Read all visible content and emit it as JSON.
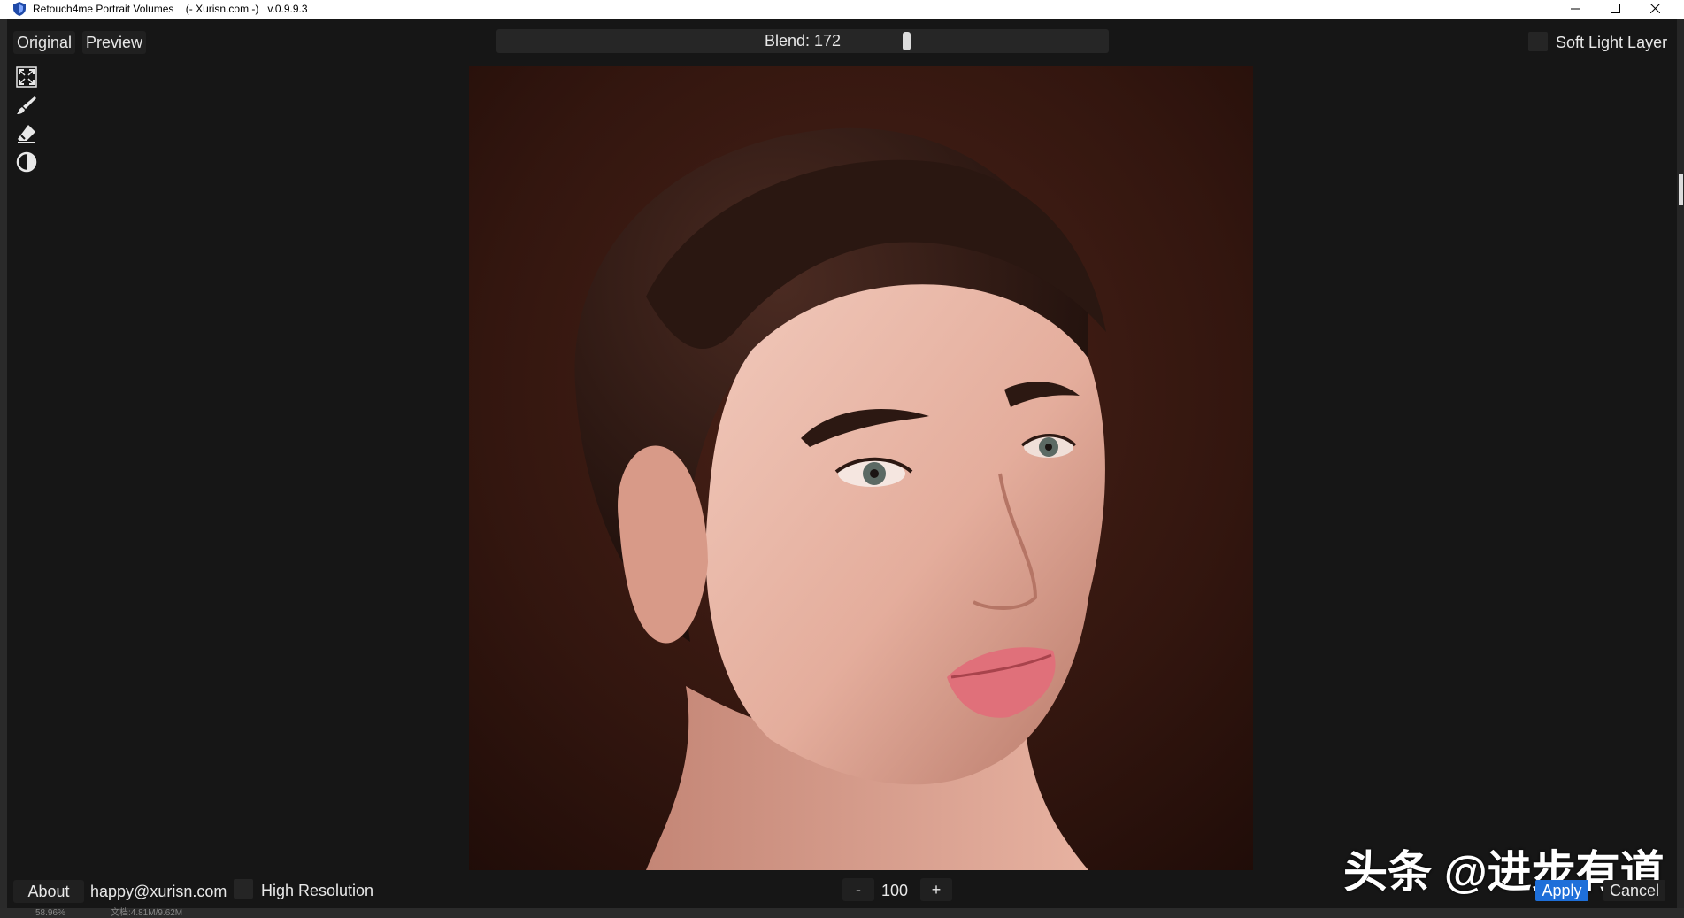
{
  "window": {
    "title": "Retouch4me Portrait Volumes    (- Xurisn.com -)   v.0.9.9.3",
    "icon": "shield-app-icon",
    "controls": [
      "minimize-icon",
      "maximize-icon",
      "close-icon"
    ]
  },
  "toolbar": {
    "original_label": "Original",
    "preview_label": "Preview",
    "blend_label": "Blend: 172",
    "blend_value": 172,
    "blend_max": 255,
    "layer_label": "Soft Light Layer",
    "layer_checked": false
  },
  "tools": [
    {
      "name": "fit-screen-icon"
    },
    {
      "name": "brush-icon"
    },
    {
      "name": "eraser-icon"
    },
    {
      "name": "contrast-icon"
    }
  ],
  "bottom": {
    "about_label": "About",
    "email": "happy@xurisn.com",
    "high_res_label": "High Resolution",
    "high_res_checked": false,
    "zoom_minus": "-",
    "zoom_value": "100",
    "zoom_plus": "+",
    "apply_label": "Apply",
    "cancel_label": "Cancel"
  },
  "watermark": "头条 @进步有道",
  "statusbar": {
    "zoom": "58.96%",
    "doc": "文档:4.81M/9.62M"
  },
  "colors": {
    "accent": "#1e6fd9",
    "panel": "#161616",
    "button": "#202020"
  }
}
